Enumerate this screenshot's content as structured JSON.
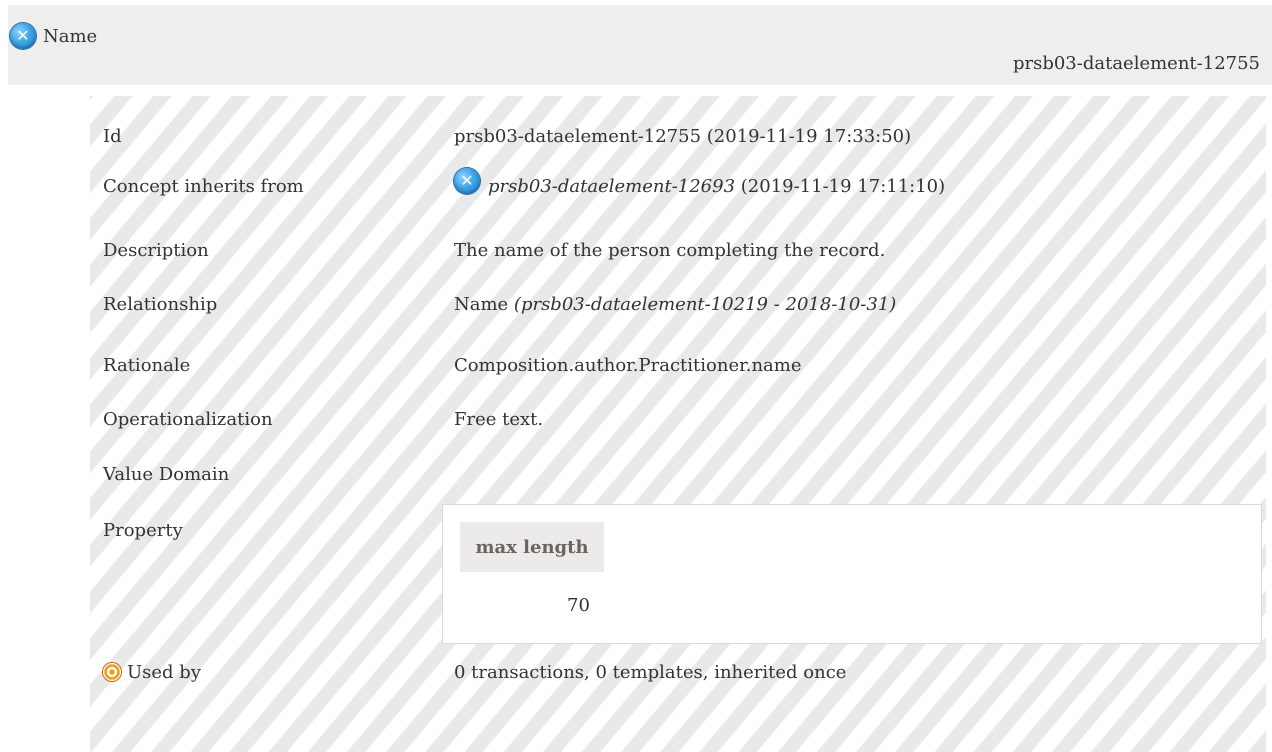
{
  "header": {
    "title": "Name",
    "id": "prsb03-dataelement-12755",
    "icon": "concept-x-icon"
  },
  "rows": {
    "id": {
      "label": "Id",
      "value": "prsb03-dataelement-12755 (2019-11-19 17:33:50)"
    },
    "inherits": {
      "label": "Concept inherits from",
      "ref": "prsb03-dataelement-12693",
      "date": " (2019-11-19 17:11:10)",
      "icon": "concept-x-icon"
    },
    "description": {
      "label": "Description",
      "value": "The name of the person completing the record."
    },
    "relationship": {
      "label": "Relationship",
      "name": "Name",
      "ref": " (prsb03-dataelement-10219 - 2018-10-31)"
    },
    "rationale": {
      "label": "Rationale",
      "value": "Composition.author.Practitioner.name"
    },
    "operationalization": {
      "label": "Operationalization",
      "value": "Free text."
    },
    "value_domain": {
      "label": "Value Domain"
    },
    "property": {
      "label": "Property",
      "header": "max length",
      "value": "70"
    },
    "used_by": {
      "label": "Used by",
      "value": "0 transactions, 0 templates, inherited once",
      "icon": "target-icon"
    }
  },
  "colors": {
    "header_bg": "#eeeeee",
    "stripe": "#e9e9e9",
    "property_header_bg": "#ecebe9"
  }
}
